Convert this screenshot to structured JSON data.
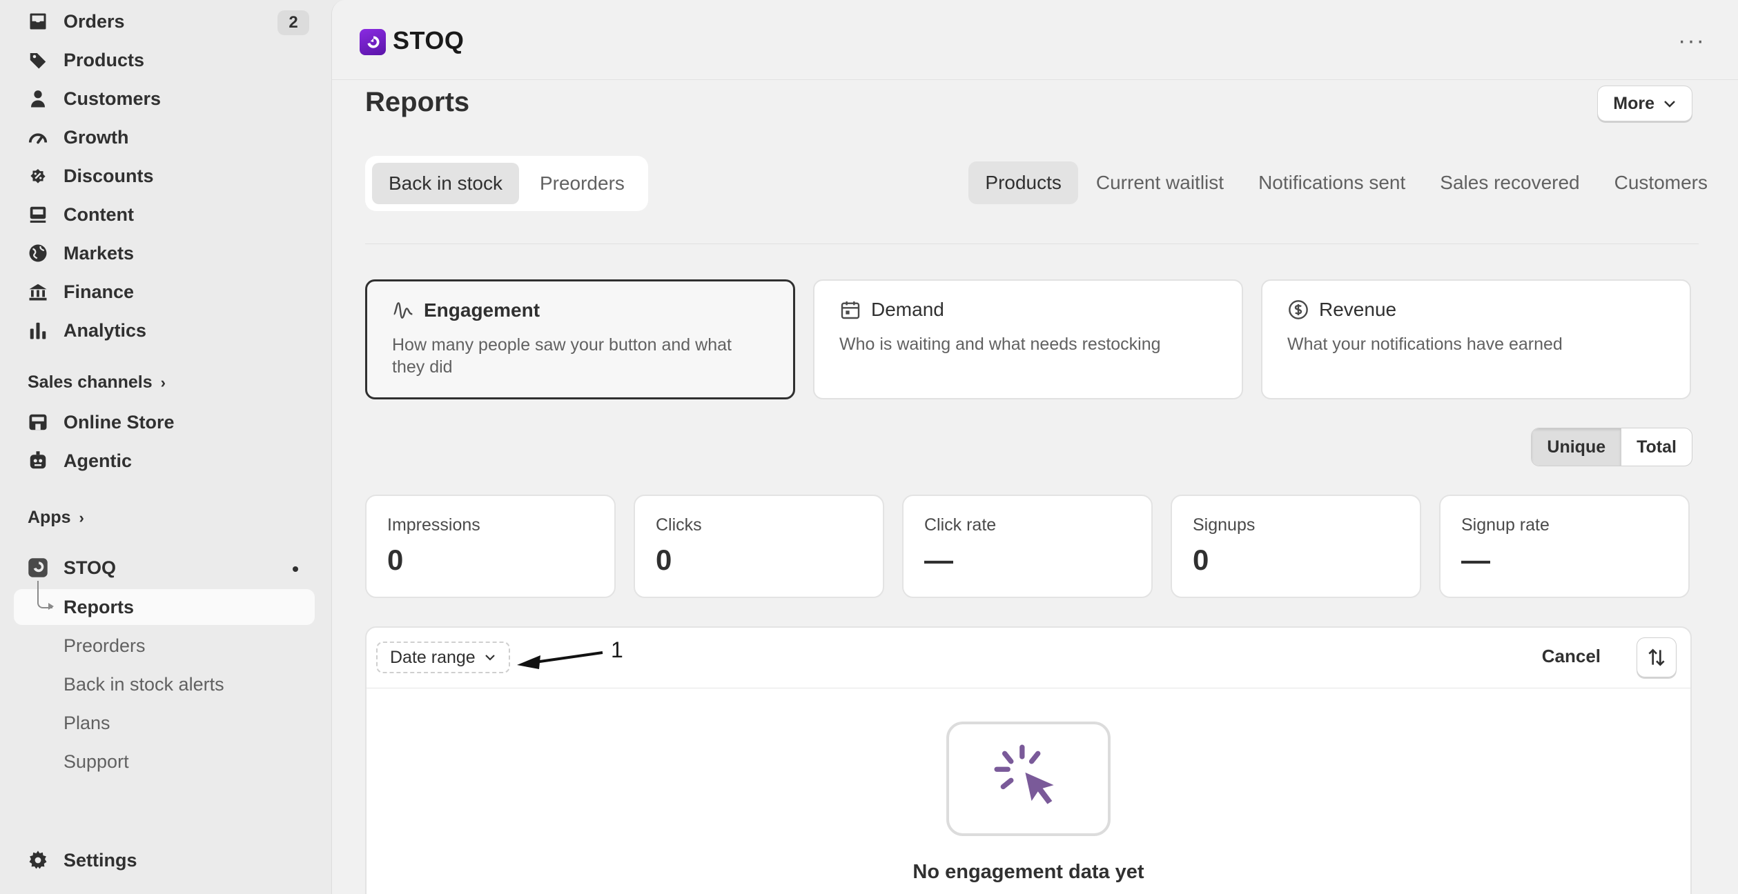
{
  "sidebar": {
    "items": [
      {
        "label": "Orders",
        "badge": "2",
        "icon": "inbox-icon"
      },
      {
        "label": "Products",
        "icon": "tag-icon"
      },
      {
        "label": "Customers",
        "icon": "person-icon"
      },
      {
        "label": "Growth",
        "icon": "gauge-icon"
      },
      {
        "label": "Discounts",
        "icon": "discount-icon"
      },
      {
        "label": "Content",
        "icon": "content-icon"
      },
      {
        "label": "Markets",
        "icon": "globe-icon"
      },
      {
        "label": "Finance",
        "icon": "bank-icon"
      },
      {
        "label": "Analytics",
        "icon": "bar-chart-icon"
      }
    ],
    "sales_channels_label": "Sales channels",
    "channels": [
      {
        "label": "Online Store",
        "icon": "store-icon"
      },
      {
        "label": "Agentic",
        "icon": "agent-icon"
      }
    ],
    "apps_label": "Apps",
    "app": {
      "label": "STOQ",
      "icon": "stoq-icon"
    },
    "app_subitems": [
      "Reports",
      "Preorders",
      "Back in stock alerts",
      "Plans",
      "Support"
    ],
    "settings_label": "Settings"
  },
  "topbar": {
    "app_name": "STOQ",
    "more_dots": "···"
  },
  "page": {
    "title": "Reports",
    "more_label": "More",
    "segments": [
      "Back in stock",
      "Preorders"
    ],
    "tabs": [
      "Products",
      "Current waitlist",
      "Notifications sent",
      "Sales recovered",
      "Customers"
    ],
    "categories": [
      {
        "title": "Engagement",
        "desc": "How many people saw your button and what they did",
        "icon": "pulse-icon"
      },
      {
        "title": "Demand",
        "desc": "Who is waiting and what needs restocking",
        "icon": "calendar-icon"
      },
      {
        "title": "Revenue",
        "desc": "What your notifications have earned",
        "icon": "dollar-circle-icon"
      }
    ],
    "toggle": [
      "Unique",
      "Total"
    ],
    "metrics": [
      {
        "label": "Impressions",
        "value": "0"
      },
      {
        "label": "Clicks",
        "value": "0"
      },
      {
        "label": "Click rate",
        "value": "—"
      },
      {
        "label": "Signups",
        "value": "0"
      },
      {
        "label": "Signup rate",
        "value": "—"
      }
    ],
    "panel": {
      "date_range_label": "Date range",
      "annotation_number": "1",
      "cancel_label": "Cancel",
      "empty_title": "No engagement data yet"
    }
  },
  "colors": {
    "accent": "#5a1e8c",
    "logo_gradient_start": "#8a2be2",
    "empty_icon": "#7a5a99"
  }
}
